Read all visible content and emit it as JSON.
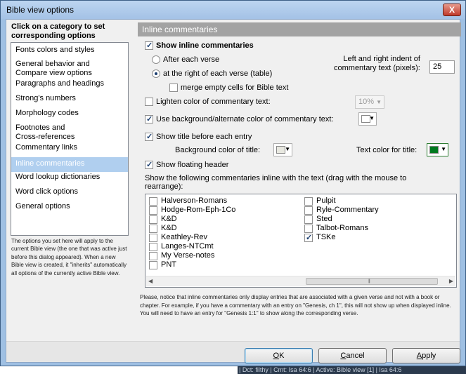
{
  "window": {
    "title": "Bible view options",
    "close_glyph": "X"
  },
  "left_panel": {
    "heading": "Click on a category to set corresponding options",
    "categories": [
      "Fonts colors and styles",
      "General behavior and\nCompare view options",
      "Paragraphs and headings",
      "Strong's numbers",
      "Morphology codes",
      "Footnotes and\nCross-references",
      "Commentary links",
      "Inline commentaries",
      "Word lookup dictionaries",
      "Word click options",
      "General options"
    ],
    "selected_index": 7,
    "note": "The options you set here will apply to the current Bible view (the one that was active just before this dialog appeared). When a new Bible view is created, it \"inherits\" automatically all options of the currently active Bible view."
  },
  "section": {
    "header": "Inline commentaries",
    "show_inline": {
      "label": "Show inline commentaries",
      "checked": true
    },
    "after_each_verse": {
      "label": "After each verse",
      "selected": false
    },
    "right_of_verse": {
      "label": "at the right of each verse (table)",
      "selected": true
    },
    "merge_empty": {
      "label": "merge empty cells for Bible text",
      "checked": false
    },
    "indent_label": "Left and right indent of\ncommentary text (pixels):",
    "indent_value": "25",
    "lighten": {
      "label": "Lighten color of commentary text:",
      "checked": false,
      "value": "10%"
    },
    "use_background": {
      "label": "Use background/alternate color of commentary text:",
      "checked": true,
      "color": "#ffffff"
    },
    "show_title": {
      "label": "Show title before each entry",
      "checked": true
    },
    "title_bg_label": "Background color of title:",
    "title_bg_color": "#e8e8e0",
    "title_text_label": "Text color for title:",
    "title_text_color": "#007a1f",
    "floating_header": {
      "label": "Show floating header",
      "checked": true
    },
    "list_label": "Show the following commentaries inline with the text (drag with the mouse to rearrange):",
    "commentaries_col1": [
      {
        "name": "Halverson-Romans",
        "checked": false
      },
      {
        "name": "Hodge-Rom-Eph-1Co",
        "checked": false
      },
      {
        "name": "K&D",
        "checked": false
      },
      {
        "name": "K&D",
        "checked": false
      },
      {
        "name": "Keathley-Rev",
        "checked": false
      },
      {
        "name": "Langes-NTCmt",
        "checked": false
      },
      {
        "name": "My Verse-notes",
        "checked": false
      },
      {
        "name": "PNT",
        "checked": false
      }
    ],
    "commentaries_col2": [
      {
        "name": "Pulpit",
        "checked": false
      },
      {
        "name": "Ryle-Commentary",
        "checked": false
      },
      {
        "name": "Sted",
        "checked": false
      },
      {
        "name": "Talbot-Romans",
        "checked": false
      },
      {
        "name": "TSKe",
        "checked": true
      }
    ],
    "notice": "Please, notice that inline commentaries only display entries that are associated with a given verse and not with a book or chapter. For example, if you have a commentary with an entry on \"Genesis, ch 1\", this will not show up when displayed inline. You will need to have an entry for \"Genesis 1:1\" to show along the corresponding verse."
  },
  "buttons": {
    "ok": {
      "label": "OK",
      "accel": "O",
      "rest": "K"
    },
    "cancel": {
      "label": "Cancel",
      "accel": "C",
      "rest": "ancel"
    },
    "apply": {
      "label": "Apply",
      "accel": "A",
      "rest": "pply"
    }
  },
  "background_status": "| Dct: filthy | Cmt: Isa 64:6 | Active: Bible view [1] | Isa 64:6"
}
